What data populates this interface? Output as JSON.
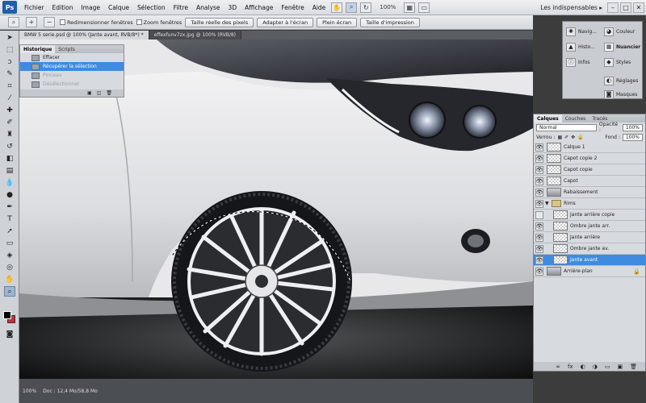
{
  "app": {
    "logo": "Ps"
  },
  "menu": [
    "Fichier",
    "Edition",
    "Image",
    "Calque",
    "Sélection",
    "Filtre",
    "Analyse",
    "3D",
    "Affichage",
    "Fenêtre",
    "Aide"
  ],
  "zoom_readout": "100%",
  "workspace": "Les indispensables ▸",
  "options": {
    "resize_windows": "Redimensionner fenêtres",
    "zoom_all": "Zoom fenêtres",
    "btn_actual": "Taille réelle des pixels",
    "btn_fit": "Adapter à l'écran",
    "btn_full": "Plein écran",
    "btn_print": "Taille d'impression"
  },
  "tabs": [
    {
      "label": "BMW 5 serie.psd @ 100% (Jante avant, RVB/8*) *"
    },
    {
      "label": "effexfunv7zx.jpg @ 100% (RVB/8)"
    }
  ],
  "history": {
    "tabs": [
      "Historique",
      "Scripts"
    ],
    "rows": [
      {
        "label": "Effacer",
        "state": "normal"
      },
      {
        "label": "Récupérer la sélection",
        "state": "active"
      },
      {
        "label": "Pinceau",
        "state": "undone"
      },
      {
        "label": "Désélectionner",
        "state": "undone"
      }
    ]
  },
  "mini_panel": {
    "items": [
      {
        "label": "Navig...",
        "icon": "navigator-icon"
      },
      {
        "label": "Couleur",
        "icon": "color-icon"
      },
      {
        "label": "Histo...",
        "icon": "histogram-icon"
      },
      {
        "label": "Nuancier",
        "icon": "swatches-icon"
      },
      {
        "label": "Infos",
        "icon": "info-icon"
      },
      {
        "label": "Styles",
        "icon": "styles-icon"
      },
      {
        "label": "Réglages",
        "icon": "adjustments-icon"
      },
      {
        "label": "Masques",
        "icon": "masks-icon"
      }
    ]
  },
  "layers": {
    "tabs": [
      "Calques",
      "Couches",
      "Tracés"
    ],
    "blend_mode": "Normal",
    "opacity_label": "Opacité :",
    "opacity": "100%",
    "lock_label": "Verrou :",
    "fill_label": "Fond :",
    "fill": "100%",
    "items": [
      {
        "name": "Calque 1",
        "visible": true,
        "indent": false,
        "type": "layer"
      },
      {
        "name": "Capot copie 2",
        "visible": true,
        "indent": false,
        "type": "layer"
      },
      {
        "name": "Capot copie",
        "visible": true,
        "indent": false,
        "type": "layer"
      },
      {
        "name": "Capot",
        "visible": true,
        "indent": false,
        "type": "layer"
      },
      {
        "name": "Rabaissement",
        "visible": true,
        "indent": false,
        "type": "image"
      },
      {
        "name": "Rims",
        "visible": true,
        "indent": false,
        "type": "group"
      },
      {
        "name": "Jante arrière copie",
        "visible": false,
        "indent": true,
        "type": "layer"
      },
      {
        "name": "Ombre jante arr.",
        "visible": true,
        "indent": true,
        "type": "layer"
      },
      {
        "name": "Jante arrière",
        "visible": true,
        "indent": true,
        "type": "layer"
      },
      {
        "name": "Ombre jante av.",
        "visible": true,
        "indent": true,
        "type": "layer"
      },
      {
        "name": "Jante avant",
        "visible": true,
        "indent": true,
        "type": "layer",
        "active": true
      },
      {
        "name": "Arrière-plan",
        "visible": true,
        "indent": false,
        "type": "image",
        "locked": true
      }
    ]
  },
  "status": {
    "zoom": "100%",
    "doc": "Doc : 12,4 Mo/58,8 Mo"
  },
  "colors": {
    "accent": "#3f8be0",
    "foreground": "#000000",
    "background": "#d02a3b"
  }
}
